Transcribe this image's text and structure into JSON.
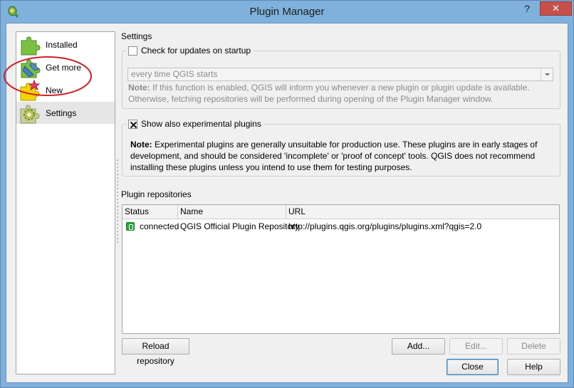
{
  "window": {
    "title": "Plugin Manager",
    "help_glyph": "?",
    "close_glyph": "✕",
    "icons": {
      "app": "qgis-logo-icon"
    }
  },
  "sidebar": {
    "items": [
      {
        "label": "Installed",
        "icon": "puzzle-green-icon"
      },
      {
        "label": "Get more",
        "icon": "puzzle-blue-icon"
      },
      {
        "label": "New",
        "icon": "puzzle-new-star-icon"
      },
      {
        "label": "Settings",
        "icon": "puzzle-gear-icon"
      }
    ],
    "selected": "Settings",
    "annotation_color": "#d0202a"
  },
  "settings": {
    "title": "Settings",
    "check_updates": {
      "label": "Check for updates on startup",
      "checked": false,
      "frequency_value": "every time QGIS starts",
      "note_bold": "Note:",
      "note_text": " If this function is enabled, QGIS will inform you whenever a new plugin or plugin update is available. Otherwise, fetching repositories will be performed during opening of the Plugin Manager window."
    },
    "experimental": {
      "label": "Show also experimental plugins",
      "checked": true,
      "note_bold": "Note:",
      "note_text": " Experimental plugins are generally unsuitable for production use. These plugins are in early stages of development, and should be considered 'incomplete' or 'proof of concept' tools. QGIS does not recommend installing these plugins unless you intend to use them for testing purposes."
    }
  },
  "repositories": {
    "title": "Plugin repositories",
    "columns": [
      "Status",
      "Name",
      "URL"
    ],
    "rows": [
      {
        "status": "connected",
        "name": "QGIS Official Plugin Repository",
        "url": "http://plugins.qgis.org/plugins/plugins.xml?qgis=2.0"
      }
    ],
    "status_color": "#27a637",
    "buttons": {
      "reload": "Reload repository",
      "add": "Add...",
      "edit": "Edit...",
      "delete": "Delete"
    }
  },
  "footer": {
    "close": "Close",
    "help": "Help"
  }
}
